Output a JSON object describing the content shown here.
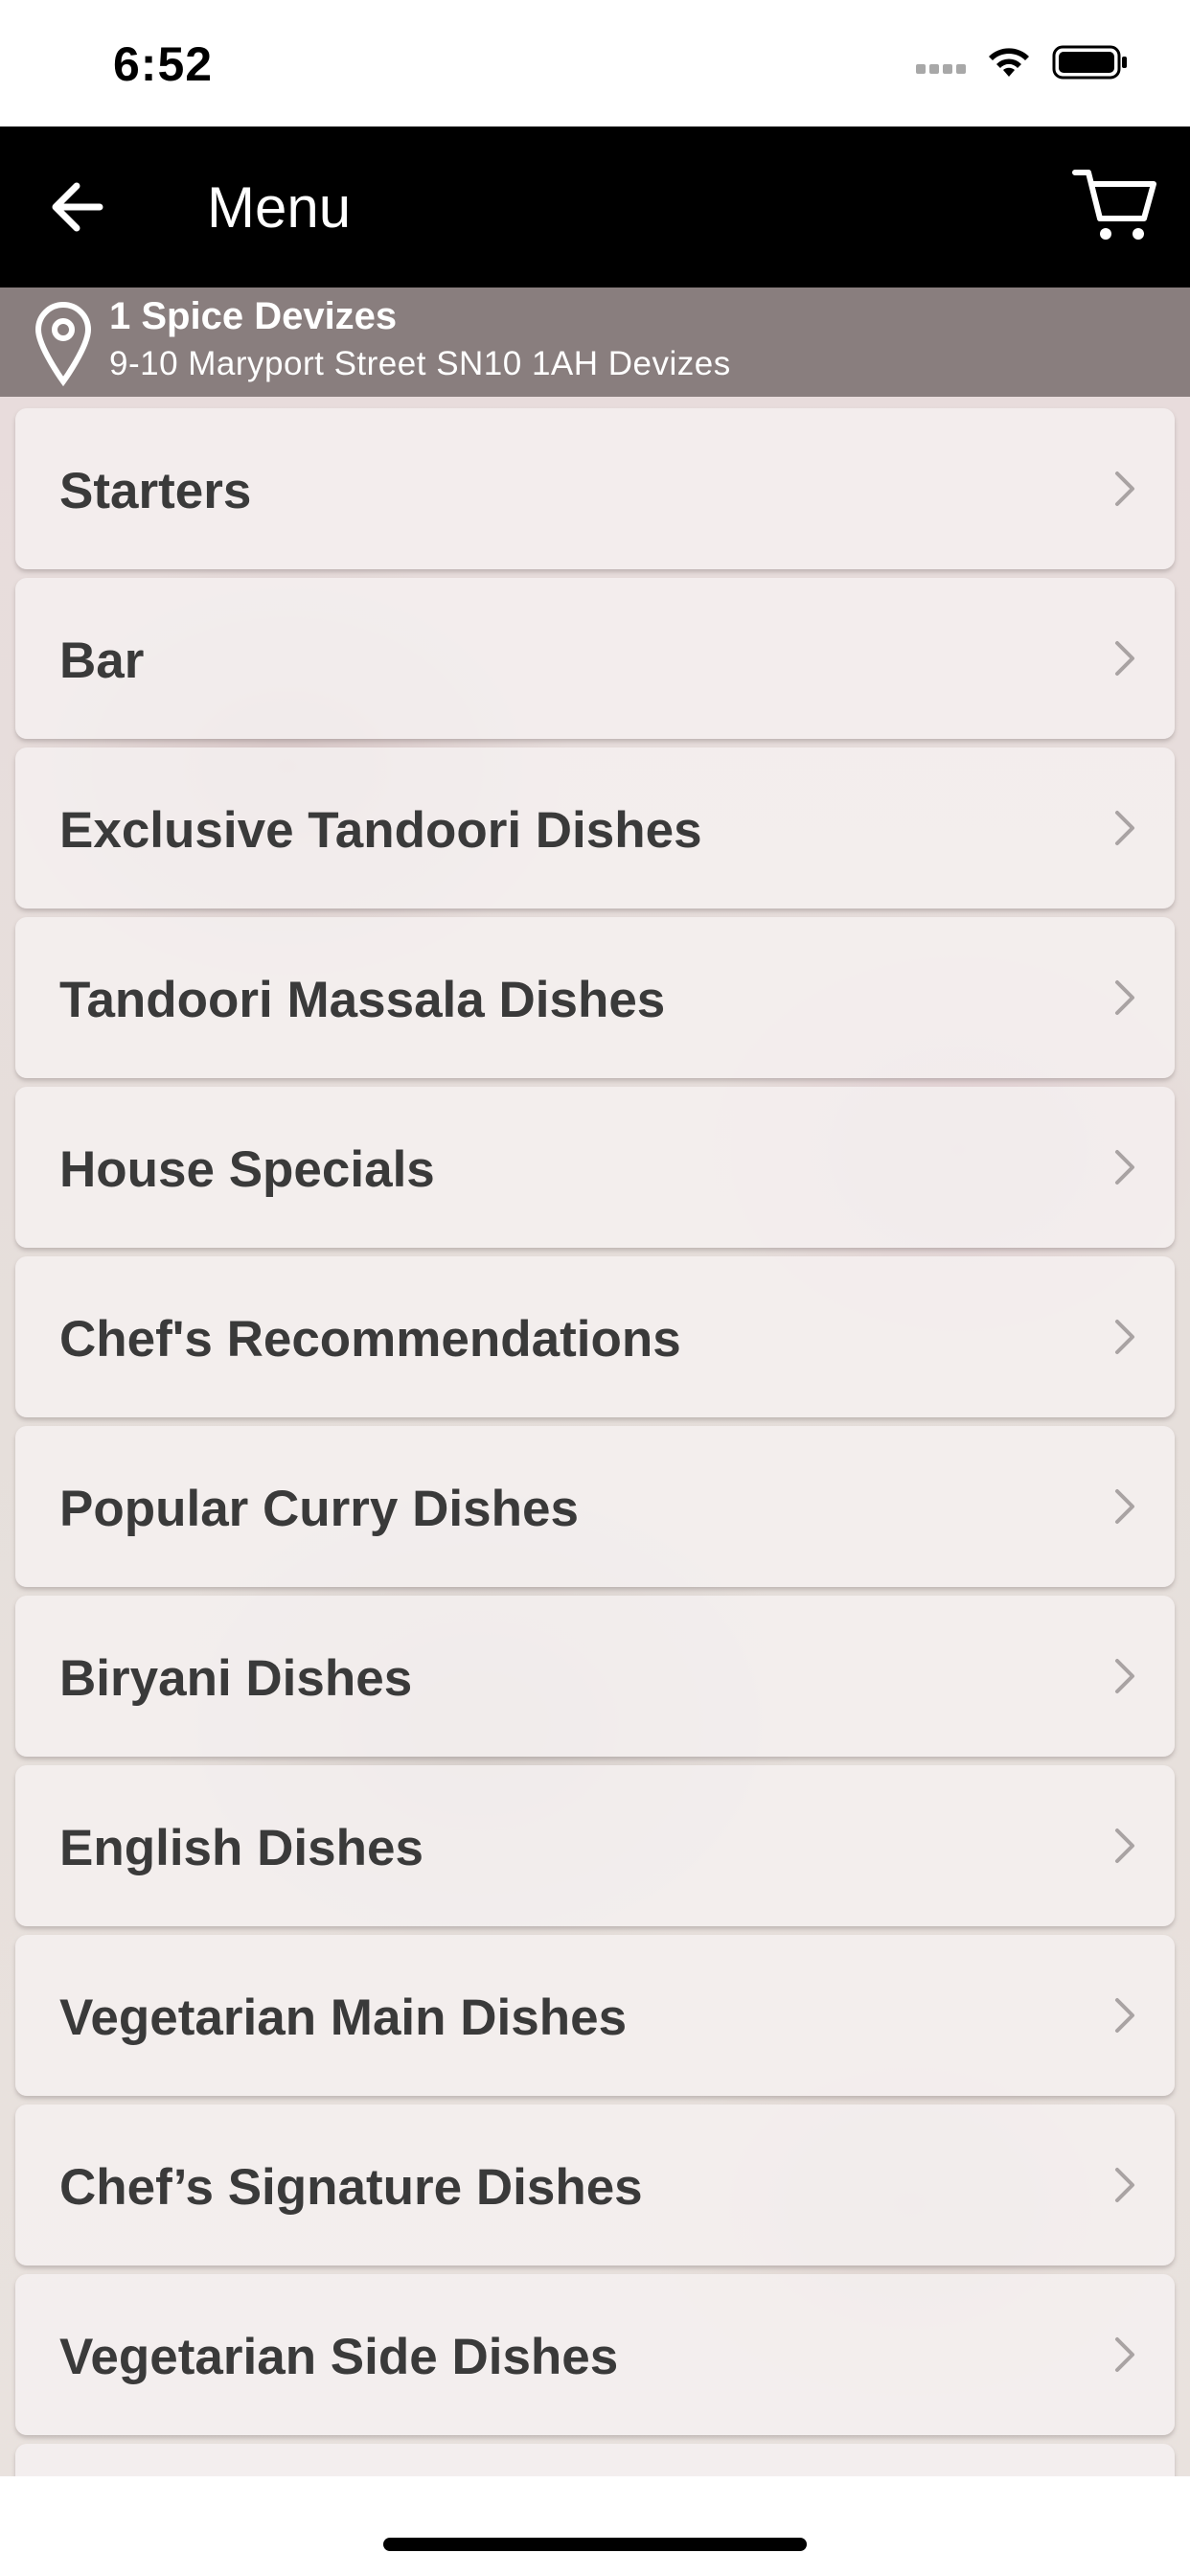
{
  "status_bar": {
    "time": "6:52",
    "icons": [
      "signal-dots-icon",
      "wifi-icon",
      "battery-icon"
    ]
  },
  "header": {
    "title": "Menu",
    "back_icon": "back-arrow-icon",
    "cart_icon": "cart-icon",
    "background": "#000000"
  },
  "location": {
    "icon": "map-pin-icon",
    "name": "1 Spice Devizes",
    "address": "9-10 Maryport Street SN10 1AH Devizes"
  },
  "menu": {
    "items": [
      {
        "label": "Starters"
      },
      {
        "label": "Bar"
      },
      {
        "label": "Exclusive Tandoori Dishes"
      },
      {
        "label": "Tandoori Massala Dishes"
      },
      {
        "label": "House Specials"
      },
      {
        "label": "Chef's Recommendations"
      },
      {
        "label": "Popular Curry Dishes"
      },
      {
        "label": "Biryani Dishes"
      },
      {
        "label": "English Dishes"
      },
      {
        "label": "Vegetarian Main Dishes"
      },
      {
        "label": "Chef’s Signature Dishes"
      },
      {
        "label": "Vegetarian Side Dishes"
      },
      {
        "label": ""
      }
    ]
  },
  "colors": {
    "item_text": "#3a3a3a",
    "chevron": "#a9a3a3",
    "location_bar": "#6e6464"
  }
}
